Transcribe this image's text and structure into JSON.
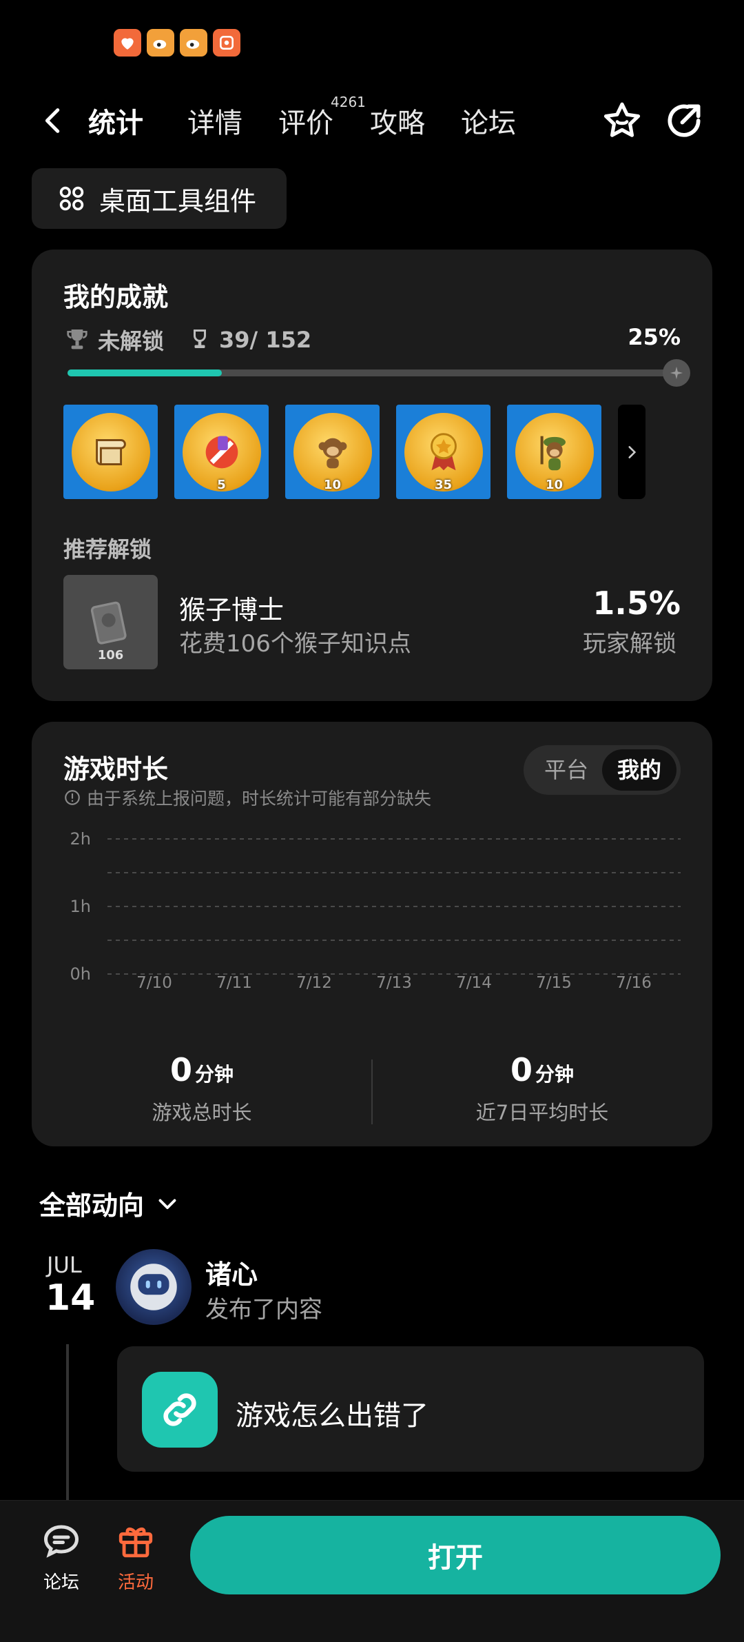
{
  "status_icons": [
    "app-icon",
    "weibo-icon",
    "weibo-icon",
    "app-icon"
  ],
  "nav": {
    "tabs": [
      {
        "label": "统计",
        "active": true
      },
      {
        "label": "详情",
        "active": false
      },
      {
        "label": "评价",
        "active": false
      },
      {
        "label": "攻略",
        "active": false
      },
      {
        "label": "论坛",
        "active": false
      }
    ],
    "review_count": "4261",
    "accent_color": "#1fc6b0"
  },
  "widget_button": {
    "label": "桌面工具组件"
  },
  "achievements": {
    "title": "我的成就",
    "locked_label": "未解锁",
    "progress_text": "39/ 152",
    "percent_text": "25%",
    "progress": 0.25,
    "badges": [
      {
        "icon": "scroll-icon",
        "count": ""
      },
      {
        "icon": "cancel-icon",
        "count": "5"
      },
      {
        "icon": "monkey-icon",
        "count": "10"
      },
      {
        "icon": "medal-icon",
        "count": "35"
      },
      {
        "icon": "soldier-monkey-icon",
        "count": "10"
      }
    ],
    "recommend_title": "推荐解锁",
    "recommend": {
      "name": "猴子博士",
      "desc": "花费106个猴子知识点",
      "badge_count": "106",
      "percent": "1.5%",
      "percent_label": "玩家解锁"
    }
  },
  "playtime": {
    "title": "游戏时长",
    "note": "由于系统上报问题，时长统计可能有部分缺失",
    "toggle": {
      "left": "平台",
      "right": "我的",
      "selected": "我的"
    },
    "total": {
      "value": "0",
      "unit": "分钟",
      "label": "游戏总时长"
    },
    "avg": {
      "value": "0",
      "unit": "分钟",
      "label": "近7日平均时长"
    }
  },
  "chart_data": {
    "type": "bar",
    "categories": [
      "7/10",
      "7/11",
      "7/12",
      "7/13",
      "7/14",
      "7/15",
      "7/16"
    ],
    "values": [
      0,
      0,
      0,
      0,
      0,
      0,
      0
    ],
    "yticks": [
      "2h",
      "1h",
      "0h"
    ],
    "ylim": [
      0,
      2
    ],
    "grid": true
  },
  "feed": {
    "header": "全部动向",
    "month": "JUL",
    "day": "14",
    "user": "诸心",
    "action": "发布了内容",
    "post_text": "游戏怎么出错了"
  },
  "bottom_bar": {
    "forum_label": "论坛",
    "activity_label": "活动",
    "activity_color": "#ff6a3d",
    "open_label": "打开"
  }
}
